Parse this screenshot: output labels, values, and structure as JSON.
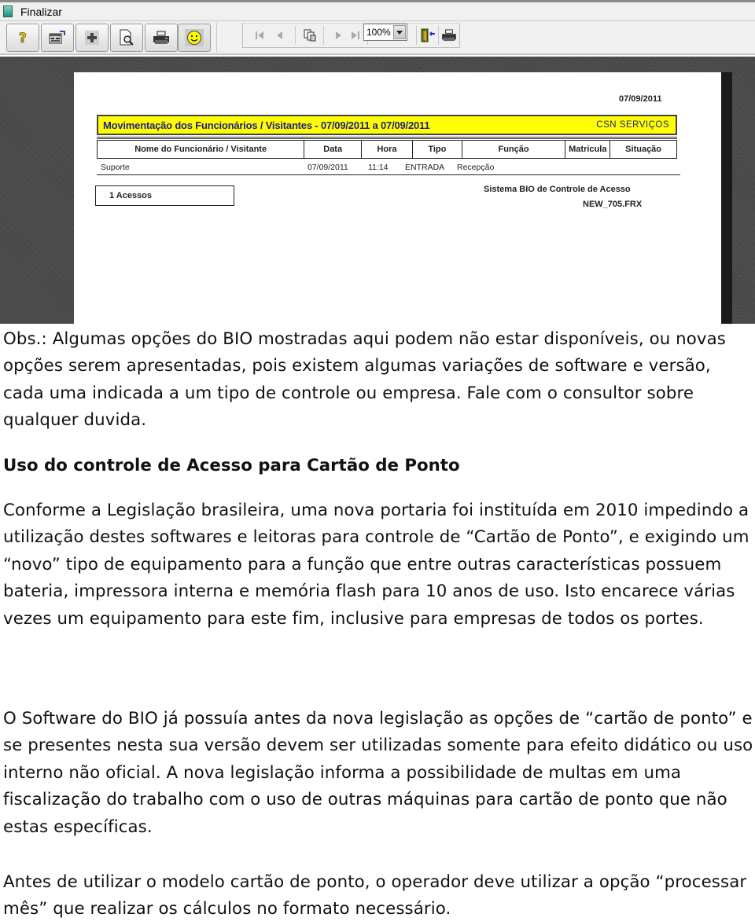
{
  "window": {
    "title": "Finalizar",
    "app_icon": "application-icon"
  },
  "toolbar": {
    "buttons": [
      {
        "name": "help-button",
        "icon": "question-mark-icon",
        "glyph": "?"
      },
      {
        "name": "properties-button",
        "icon": "window-properties-icon",
        "glyph": ""
      },
      {
        "name": "add-button",
        "icon": "plus-icon",
        "glyph": "+"
      },
      {
        "name": "preview-button",
        "icon": "magnifier-document-icon",
        "glyph": ""
      },
      {
        "name": "print-button",
        "icon": "printer-icon",
        "glyph": ""
      },
      {
        "name": "smiley-button",
        "icon": "smiley-icon",
        "glyph": ""
      }
    ],
    "nav": {
      "first_page": "first-page-icon",
      "previous_page": "previous-page-icon",
      "multi_page": "multiple-pages-icon",
      "next_page": "next-page-icon",
      "last_page": "last-page-icon",
      "zoom_value": "100%",
      "exit": "exit-door-icon",
      "print": "printer-icon"
    }
  },
  "report": {
    "print_date": "07/09/2011",
    "title": "Movimentação dos Funcionários / Visitantes - 07/09/2011 a 07/09/2011",
    "company": "CSN SERVIÇOS",
    "columns": [
      "Nome do Funcionário / Visitante",
      "Data",
      "Hora",
      "Tipo",
      "Função",
      "Matricula",
      "Situação"
    ],
    "rows": [
      {
        "nome": "Suporte",
        "data": "07/09/2011",
        "hora": "11:14",
        "tipo": "ENTRADA",
        "funcao": "Recepção",
        "matricula": "",
        "situacao": ""
      }
    ],
    "total": "1 Acessos",
    "system_name": "Sistema BIO de Controle de Acesso",
    "file_name": "NEW_705.FRX",
    "colors": {
      "title_bg": "#ffff00",
      "title_text": "#1e1e8c"
    }
  },
  "document": {
    "obs": "Obs.: Algumas opções do BIO mostradas aqui podem não estar disponíveis, ou novas opções serem apresentadas, pois existem algumas variações de software e versão, cada uma indicada a um tipo de controle ou empresa. Fale com o consultor sobre qualquer duvida.",
    "heading": "Uso do controle de Acesso para Cartão de Ponto",
    "paragraphs": [
      "Conforme a Legislação brasileira, uma nova portaria foi instituída em 2010 impedindo a utilização destes softwares e leitoras para controle de “Cartão de Ponto”, e exigindo um “novo” tipo de equipamento para a função que entre outras características possuem bateria, impressora interna e memória flash para 10 anos de uso. Isto encarece várias vezes um equipamento para este fim, inclusive para empresas de todos os portes.",
      "O Software do BIO já possuía antes da nova legislação as opções de “cartão de ponto” e se presentes nesta sua versão devem ser utilizadas somente para efeito didático ou uso interno não oficial. A nova legislação informa a possibilidade de multas em uma fiscalização do trabalho com o uso de outras máquinas para cartão de ponto que não estas específicas.",
      "Antes de utilizar o modelo cartão de ponto, o operador deve utilizar a opção “processar mês” que realizar os cálculos no formato necessário."
    ]
  }
}
